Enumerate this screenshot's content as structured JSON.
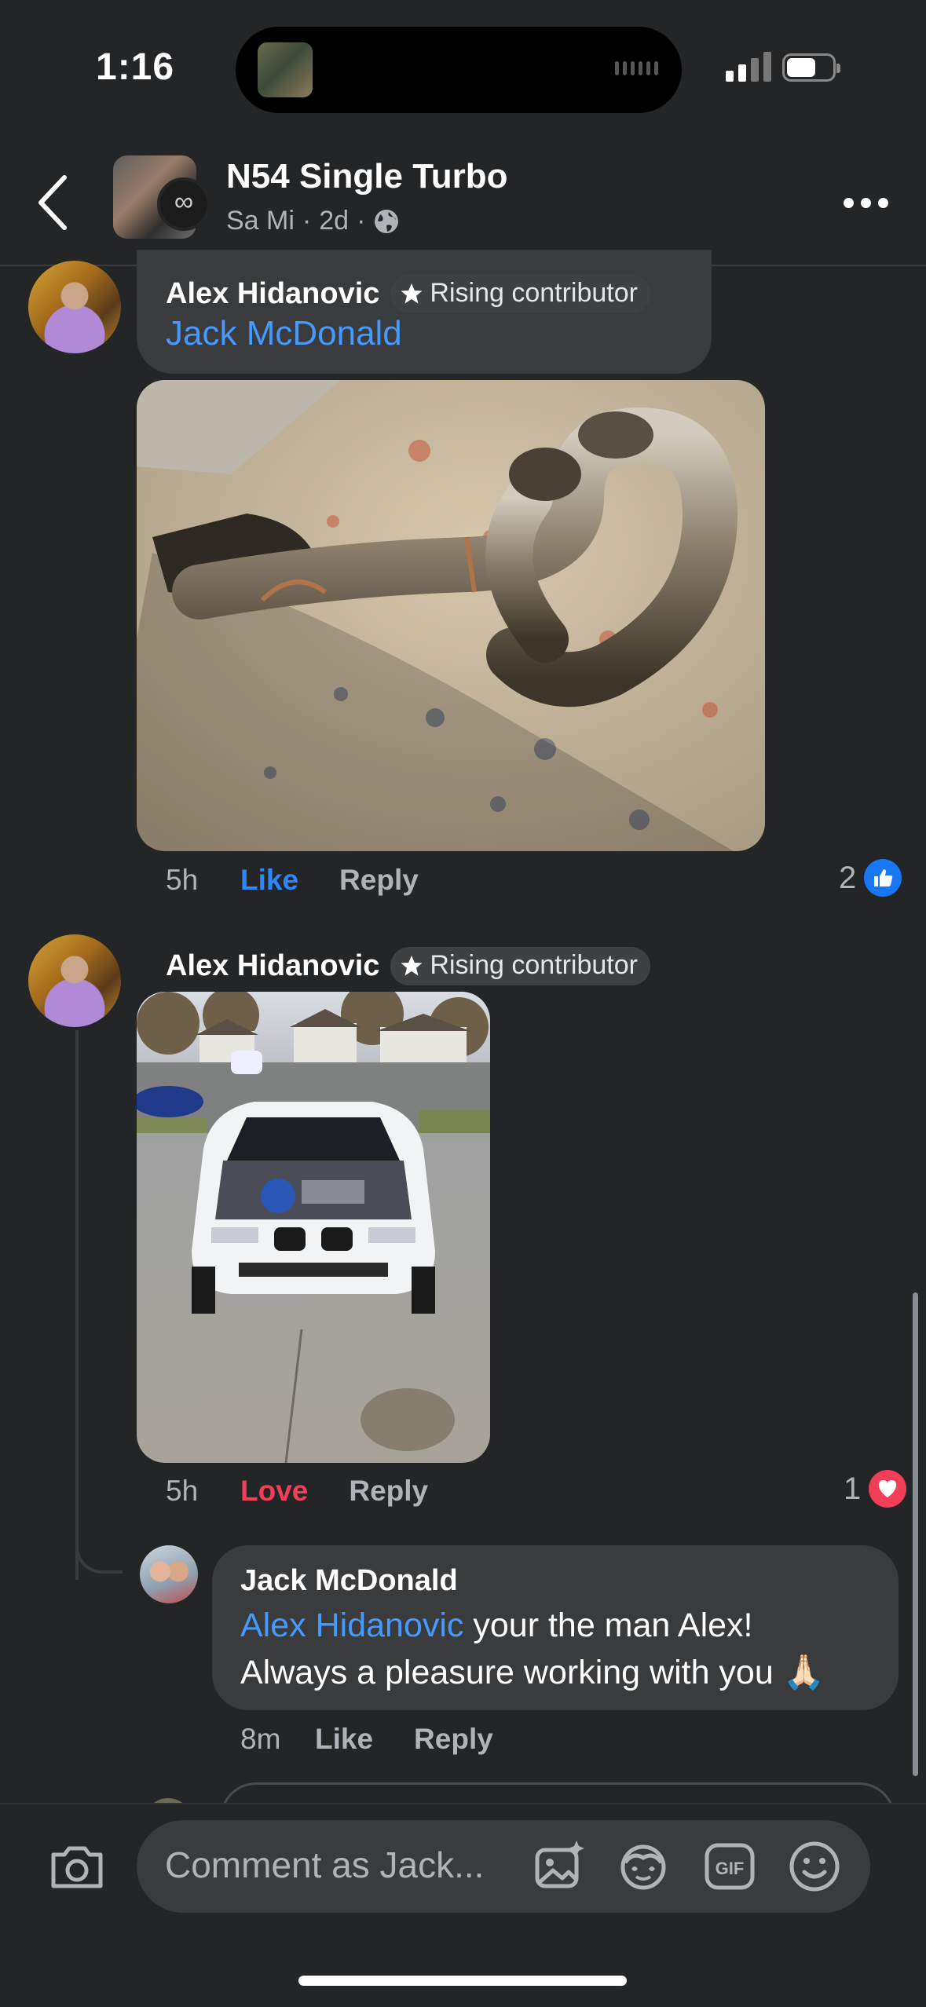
{
  "status": {
    "time": "1:16"
  },
  "header": {
    "title": "N54 Single Turbo",
    "author": "Sa Mi",
    "age": "2d",
    "separator": "·"
  },
  "comments": [
    {
      "author": "Alex Hidanovic",
      "badge": "Rising contributor",
      "mention": "Jack McDonald",
      "time": "5h",
      "like_label": "Like",
      "reply_label": "Reply",
      "reaction_count": "2",
      "reaction": "like"
    },
    {
      "author": "Alex Hidanovic",
      "badge": "Rising contributor",
      "time": "5h",
      "like_label": "Love",
      "reply_label": "Reply",
      "reaction_count": "1",
      "reaction": "love"
    }
  ],
  "reply": {
    "author": "Jack McDonald",
    "mention": "Alex Hidanovic",
    "text_line1": " your the man Alex!",
    "text_line2": "Always a pleasure working with you 🙏🏻",
    "time": "8m",
    "like_label": "Like",
    "reply_label": "Reply"
  },
  "composer": {
    "placeholder": "Comment as Jack...",
    "gif_label": "GIF"
  },
  "colors": {
    "background": "#242527",
    "bubble": "#3a3b3c",
    "link": "#4599ff",
    "like_blue": "#2d88ff",
    "love_red": "#f33e58"
  }
}
